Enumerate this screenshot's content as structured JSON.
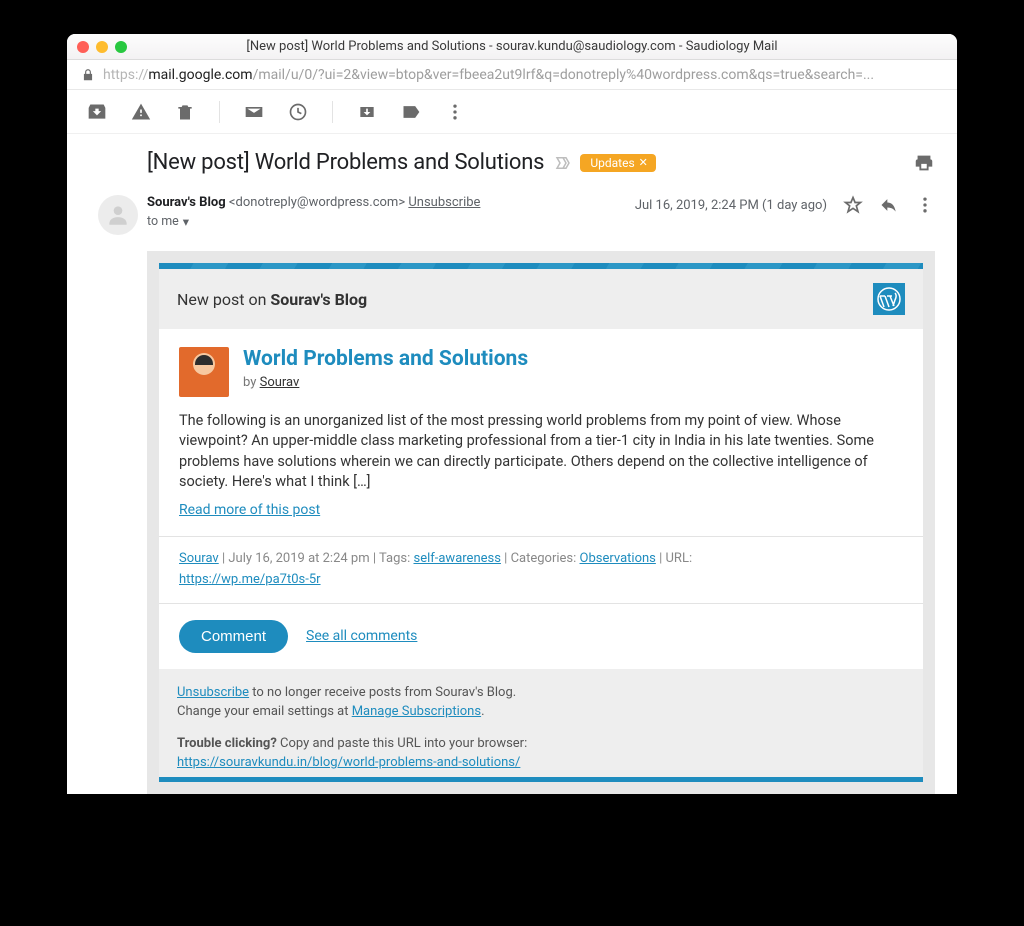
{
  "window": {
    "title": "[New post] World Problems and Solutions - sourav.kundu@saudiology.com - Saudiology Mail"
  },
  "urlbar": {
    "protocol": "https://",
    "host": "mail.google.com",
    "rest": "/mail/u/0/?ui=2&view=btop&ver=fbeea2ut9lrf&q=donotreply%40wordpress.com&qs=true&search=..."
  },
  "subject": {
    "text": "[New post] World Problems and Solutions",
    "label": "Updates"
  },
  "header": {
    "sender_name": "Sourav's Blog",
    "sender_email": "<donotreply@wordpress.com>",
    "unsubscribe": "Unsubscribe",
    "to": "to me",
    "date": "Jul 16, 2019, 2:24 PM (1 day ago)"
  },
  "wphead": {
    "prefix": "New post on ",
    "blogname": "Sourav's Blog"
  },
  "post": {
    "title": "World Problems and Solutions",
    "by_prefix": "by ",
    "author": "Sourav",
    "excerpt": "The following is an unorganized list of the most pressing world problems from my point of view. Whose viewpoint? An upper-middle class marketing professional from a tier-1 city in India in his late twenties. Some problems have solutions wherein we can directly participate. Others depend on the collective intelligence of society. Here's what I think […]",
    "readmore": "Read more of this post"
  },
  "meta": {
    "author": "Sourav",
    "datetime": " | July 16, 2019 at 2:24 pm | Tags: ",
    "tag": "self-awareness",
    "cat_prefix": " | Categories: ",
    "category": "Observations",
    "url_prefix": " | URL: ",
    "shorturl": "https://wp.me/pa7t0s-5r"
  },
  "actions": {
    "comment": "Comment",
    "seeall": "See all comments"
  },
  "footer": {
    "unsub": "Unsubscribe",
    "unsub_rest": " to no longer receive posts from Sourav's Blog.",
    "change_prefix": "Change your email settings at ",
    "manage": "Manage Subscriptions",
    "period": ".",
    "trouble_bold": "Trouble clicking?",
    "trouble_rest": " Copy and paste this URL into your browser:",
    "fullurl": "https://souravkundu.in/blog/world-problems-and-solutions/"
  }
}
